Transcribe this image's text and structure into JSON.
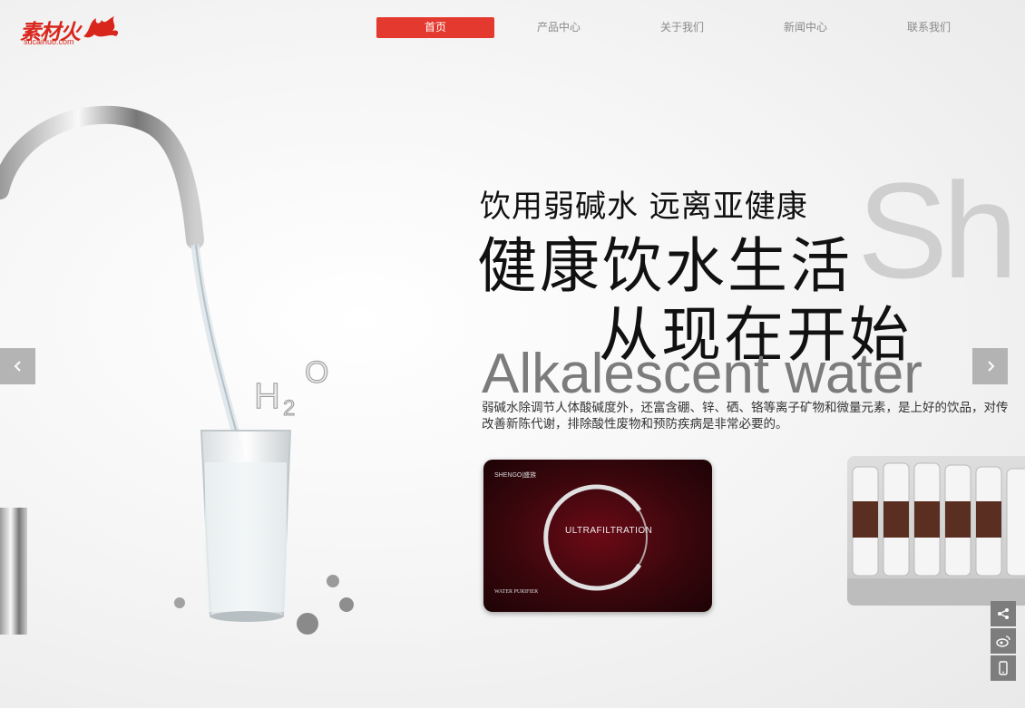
{
  "logo": {
    "main": "素材火",
    "sub": "sucaihuo.com"
  },
  "nav": [
    {
      "label": "首页",
      "active": true
    },
    {
      "label": "产品中心",
      "active": false
    },
    {
      "label": "关于我们",
      "active": false
    },
    {
      "label": "新闻中心",
      "active": false
    },
    {
      "label": "联系我们",
      "active": false
    }
  ],
  "hero": {
    "tagline_small": "饮用弱碱水 远离亚健康",
    "tagline_big_1": "健康饮水生活",
    "tagline_big_2": "从现在开始",
    "bg_letters": "Sh",
    "english_title": "Alkalescent water",
    "description_1": "弱碱水除调节人体酸碱度外，还富含硼、锌、硒、铬等离子矿物和微量元素，是上好的饮品，对传",
    "description_2": "改善新陈代谢，排除酸性废物和预防疾病是非常必要的。",
    "glass_label": "H2O"
  },
  "product": {
    "brand": "SHENGO|盛族",
    "center_label": "ULTRAFILTRATION",
    "footer_label": "WATER PURIFIER"
  },
  "controls": {
    "prev_icon": "chevron-left-icon",
    "next_icon": "chevron-right-icon"
  },
  "side_tools": [
    "share-icon",
    "weibo-icon",
    "mobile-icon"
  ],
  "colors": {
    "accent": "#e4392e",
    "brand": "#d9261c"
  }
}
